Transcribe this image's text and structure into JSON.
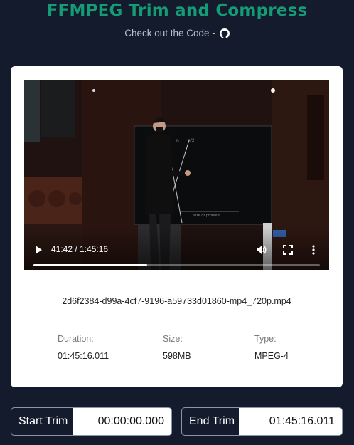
{
  "header": {
    "title": "FFMPEG Trim and Compress",
    "subtitle": "Check out the Code -",
    "github_icon": "github-icon"
  },
  "player": {
    "time_display": "41:42 / 1:45:16",
    "progress": 0.396,
    "icons": [
      "play-icon",
      "volume-icon",
      "fullscreen-icon",
      "more-options-icon"
    ]
  },
  "file": {
    "name": "2d6f2384-d99a-4cf7-9196-a59733d01860-mp4_720p.mp4",
    "duration_label": "Duration:",
    "duration": "01:45:16.011",
    "size_label": "Size:",
    "size": "598MB",
    "type_label": "Type:",
    "type": "MPEG-4"
  },
  "trim": {
    "start_label": "Start Trim",
    "start_value": "00:00:00.000",
    "end_label": "End Trim",
    "end_value": "01:45:16.011"
  },
  "colors": {
    "background": "#141b2d",
    "accent": "#149c77",
    "card": "#ffffff"
  }
}
